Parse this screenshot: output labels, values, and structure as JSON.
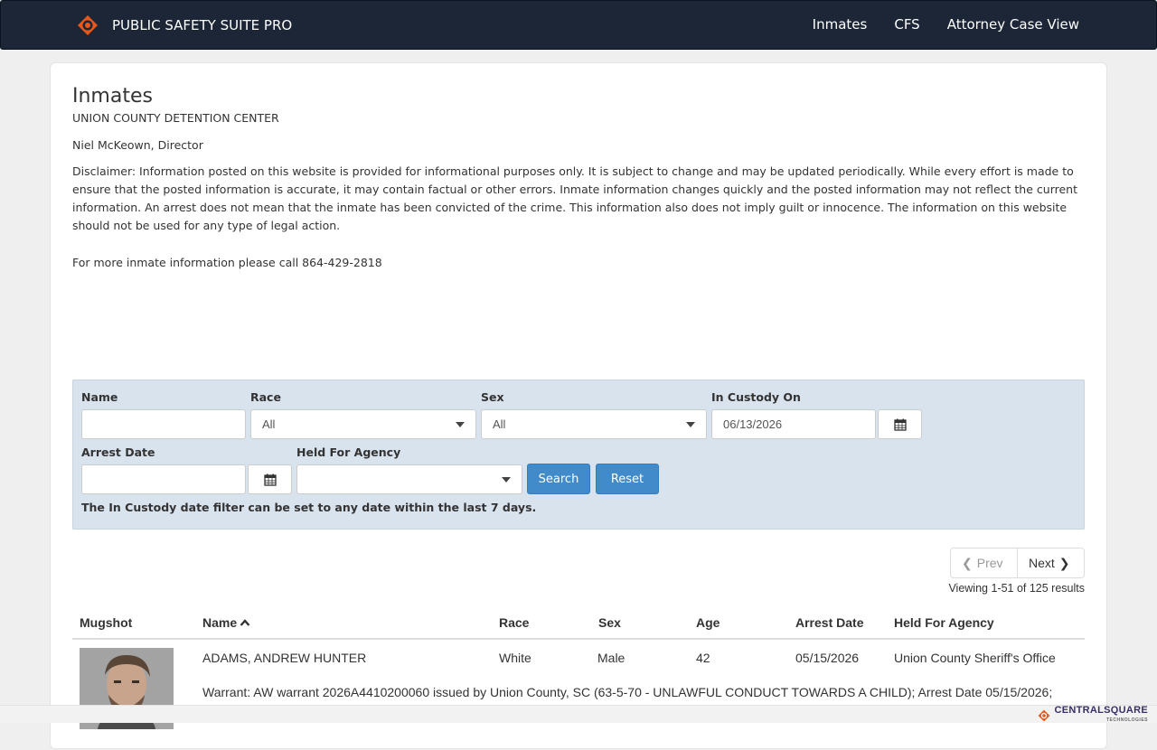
{
  "navbar": {
    "brand": "PUBLIC SAFETY SUITE PRO",
    "links": [
      "Inmates",
      "CFS",
      "Attorney Case View"
    ]
  },
  "header": {
    "title": "Inmates",
    "organization": "UNION COUNTY DETENTION CENTER",
    "director": "Niel McKeown, Director",
    "disclaimer": "Disclaimer: Information posted on this website is provided for informational purposes only. It is subject to change and may be updated periodically. While every effort is made to ensure that the posted information is accurate, it may contain factual or other errors. Inmate information changes quickly and the posted information may not reflect the current information. An arrest does not mean that the inmate has been convicted of the crime. This information also does not imply guilt or innocence.  The information on this website should not be used for any type of legal action.",
    "more_info": "For more inmate information please call 864-429-2818"
  },
  "search": {
    "name_label": "Name",
    "name_value": "",
    "race_label": "Race",
    "race_value": "All",
    "sex_label": "Sex",
    "sex_value": "All",
    "custody_label": "In Custody On",
    "custody_value": "06/13/2026",
    "arrest_label": "Arrest Date",
    "arrest_value": "",
    "agency_label": "Held For Agency",
    "agency_value": "",
    "search_button": "Search",
    "reset_button": "Reset",
    "hint": "The In Custody date filter can be set to any date within the last 7 days."
  },
  "pager": {
    "prev": "Prev",
    "next": "Next",
    "viewing": "Viewing 1-51 of 125 results"
  },
  "table": {
    "columns": [
      "Mugshot",
      "Name",
      "Race",
      "Sex",
      "Age",
      "Arrest Date",
      "Held For Agency"
    ],
    "rows": [
      {
        "name": "ADAMS, ANDREW HUNTER",
        "race": "White",
        "sex": "Male",
        "age": "42",
        "arrest_date": "05/15/2026",
        "agency": "Union County Sheriff's Office",
        "charges": "Warrant: AW warrant 2026A4410200060 issued by Union County, SC (63-5-70 - UNLAWFUL CONDUCT TOWARDS A CHILD); Arrest Date 05/15/2026;"
      }
    ]
  },
  "footer": {
    "brand": "CENTRALSQUARE",
    "sub": "TECHNOLOGIES"
  },
  "colors": {
    "navbar": "#1c2636",
    "accent_orange": "#e8571b",
    "panel": "#d9e3ee",
    "button": "#428bca"
  }
}
